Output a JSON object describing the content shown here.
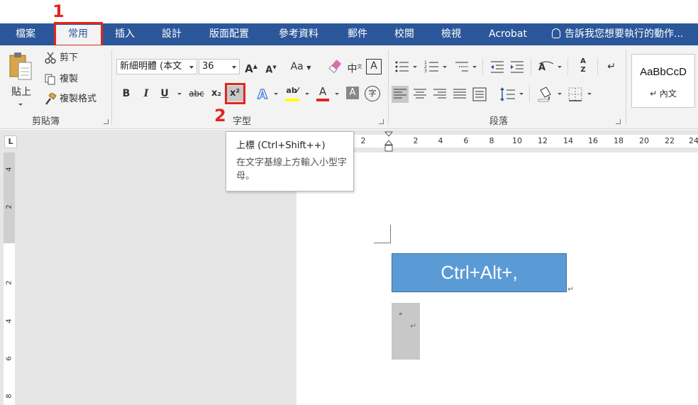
{
  "annotations": {
    "step1": "1",
    "step2": "2"
  },
  "tabs": [
    {
      "label": "檔案"
    },
    {
      "label": "常用"
    },
    {
      "label": "插入"
    },
    {
      "label": "設計"
    },
    {
      "label": "版面配置"
    },
    {
      "label": "參考資料"
    },
    {
      "label": "郵件"
    },
    {
      "label": "校閱"
    },
    {
      "label": "檢視"
    },
    {
      "label": "Acrobat"
    }
  ],
  "tell_me": "告訴我您想要執行的動作...",
  "clipboard": {
    "paste_label": "貼上",
    "cut_label": "剪下",
    "copy_label": "複製",
    "format_painter_label": "複製格式",
    "group_label": "剪貼簿"
  },
  "font": {
    "font_name": "新細明體 (本文",
    "font_size": "36",
    "grow_label": "A",
    "shrink_label": "A",
    "case_label": "Aa",
    "bold_label": "B",
    "italic_label": "I",
    "underline_label": "U",
    "strike_label": "abc",
    "subscript_label": "x₂",
    "superscript_label": "x²",
    "group_label": "字型",
    "phonetic_label": "中",
    "enclose_label": "字",
    "border_label": "A"
  },
  "paragraph": {
    "group_label": "段落",
    "sort_label": "A↓Z"
  },
  "styles": {
    "preview": "AaBbCcD",
    "name": "↵ 內文"
  },
  "tooltip": {
    "title": "上標 (Ctrl+Shift++)",
    "desc": "在文字基線上方輸入小型字母。"
  },
  "ruler": {
    "h_ticks": [
      "2",
      "2",
      "4",
      "6",
      "8",
      "10",
      "12",
      "14",
      "16",
      "18",
      "20",
      "22",
      "24"
    ],
    "v_ticks": [
      "4",
      "2",
      "2",
      "4",
      "6",
      "8"
    ],
    "tab_selector": "L"
  },
  "document": {
    "shortcut_text": "Ctrl+Alt+,",
    "dot": "°"
  },
  "colors": {
    "tab_bar": "#2b579a",
    "ribbon": "#f3f3f3",
    "annotation_red": "#e0271e",
    "text_box_blue": "#5b9bd5",
    "highlight_yellow": "#ffff00",
    "font_color_red": "#e0271e"
  }
}
